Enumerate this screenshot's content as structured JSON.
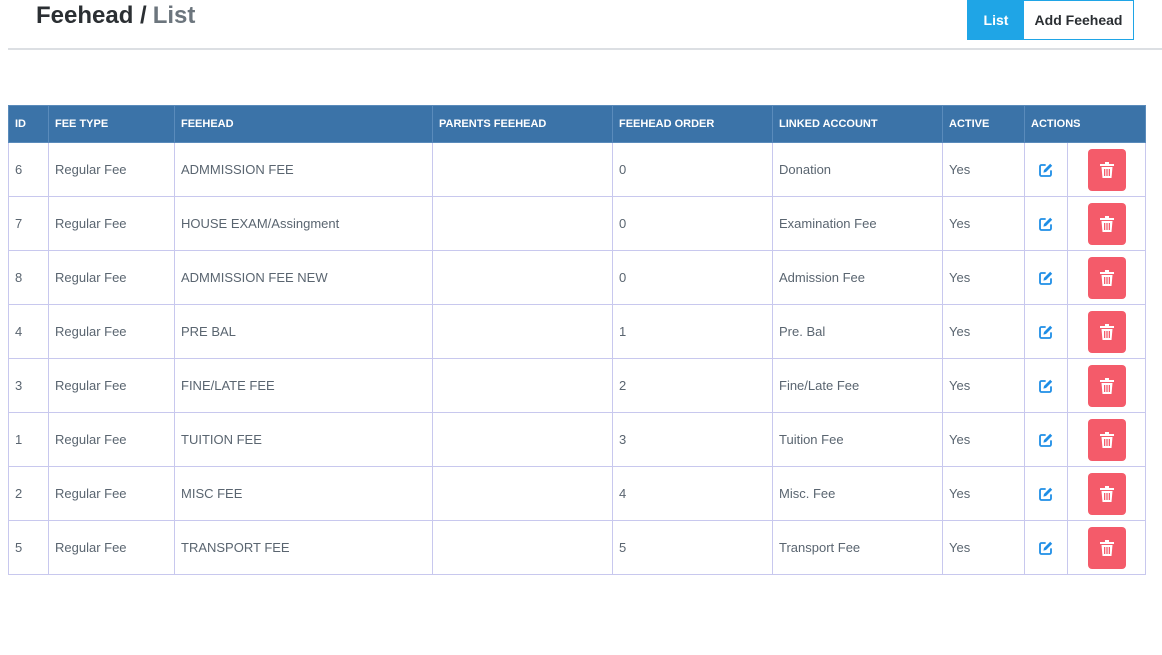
{
  "header": {
    "title": "Feehead /",
    "crumb": "List",
    "list_button": "List",
    "add_button": "Add Feehead"
  },
  "table": {
    "columns": [
      "ID",
      "FEE TYPE",
      "FEEHEAD",
      "PARENTS FEEHEAD",
      "FEEHEAD ORDER",
      "LINKED ACCOUNT",
      "ACTIVE",
      "ACTIONS"
    ],
    "rows": [
      {
        "id": "6",
        "fee_type": "Regular Fee",
        "feehead": "ADMMISSION FEE",
        "parent": "",
        "order": "0",
        "account": "Donation",
        "active": "Yes"
      },
      {
        "id": "7",
        "fee_type": "Regular Fee",
        "feehead": "HOUSE EXAM/Assingment",
        "parent": "",
        "order": "0",
        "account": "Examination Fee",
        "active": "Yes"
      },
      {
        "id": "8",
        "fee_type": "Regular Fee",
        "feehead": "ADMMISSION FEE NEW",
        "parent": "",
        "order": "0",
        "account": "Admission Fee",
        "active": "Yes"
      },
      {
        "id": "4",
        "fee_type": "Regular Fee",
        "feehead": "PRE BAL",
        "parent": "",
        "order": "1",
        "account": "Pre. Bal",
        "active": "Yes"
      },
      {
        "id": "3",
        "fee_type": "Regular Fee",
        "feehead": "FINE/LATE FEE",
        "parent": "",
        "order": "2",
        "account": "Fine/Late Fee",
        "active": "Yes"
      },
      {
        "id": "1",
        "fee_type": "Regular Fee",
        "feehead": "TUITION FEE",
        "parent": "",
        "order": "3",
        "account": "Tuition Fee",
        "active": "Yes"
      },
      {
        "id": "2",
        "fee_type": "Regular Fee",
        "feehead": "MISC FEE",
        "parent": "",
        "order": "4",
        "account": "Misc. Fee",
        "active": "Yes"
      },
      {
        "id": "5",
        "fee_type": "Regular Fee",
        "feehead": "TRANSPORT FEE",
        "parent": "",
        "order": "5",
        "account": "Transport Fee",
        "active": "Yes"
      }
    ]
  },
  "icons": {
    "edit": "edit-icon",
    "delete": "trash-icon"
  },
  "colors": {
    "accent": "#1fa5e6",
    "header_bg": "#3b73a8",
    "delete": "#f45b6a",
    "edit": "#1f8ee6"
  }
}
